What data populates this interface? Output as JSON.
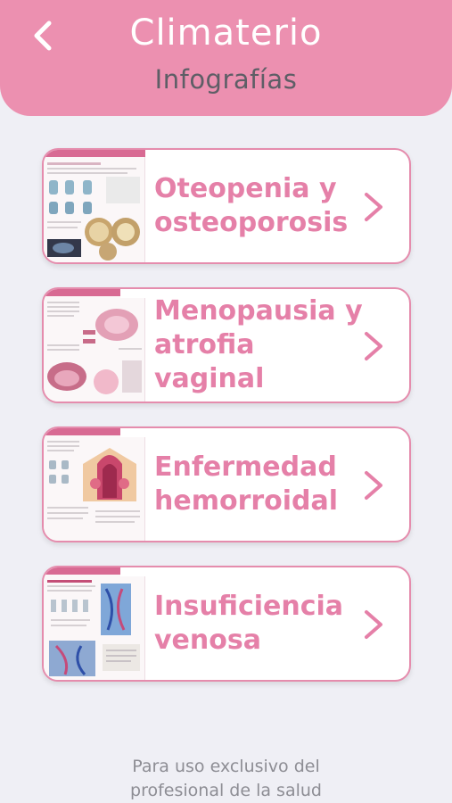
{
  "header": {
    "title": "Climaterio",
    "subtitle": "Infografías",
    "back_icon": "chevron-left-icon"
  },
  "colors": {
    "header_bg": "#ec90b0",
    "accent": "#e580a8",
    "page_bg": "#efeff5",
    "subtitle_text": "#5e5e66",
    "footer_text": "#8d8d94"
  },
  "cards": [
    {
      "label": "Oteopenia y\nosteoporosis",
      "icon": "chevron-right-icon"
    },
    {
      "label": "Menopausia y\natrofia vaginal",
      "icon": "chevron-right-icon"
    },
    {
      "label": "Enfermedad\nhemorroidal",
      "icon": "chevron-right-icon"
    },
    {
      "label": "Insuficiencia\nvenosa",
      "icon": "chevron-right-icon"
    }
  ],
  "footer": {
    "disclaimer": "Para uso exclusivo del\nprofesional de la salud"
  }
}
